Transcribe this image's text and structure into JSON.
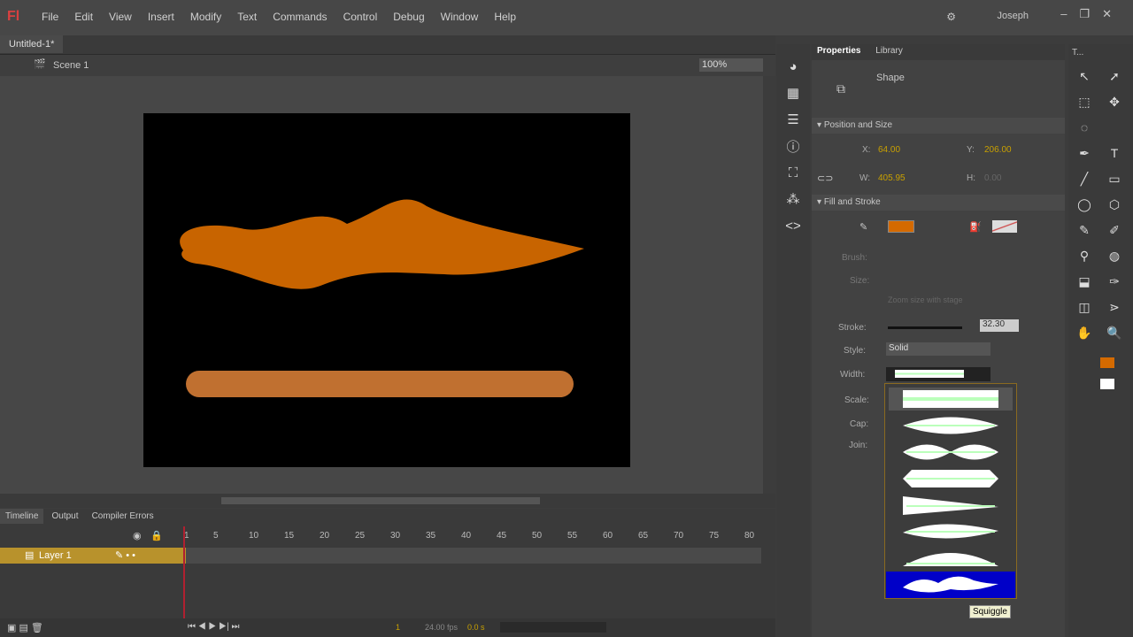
{
  "app": {
    "logo": "Fl",
    "menus": [
      "File",
      "Edit",
      "View",
      "Insert",
      "Modify",
      "Text",
      "Commands",
      "Control",
      "Debug",
      "Window",
      "Help"
    ],
    "user": "Joseph"
  },
  "document": {
    "tab": "Untitled-1*",
    "scene": "Scene 1",
    "zoom": "100%"
  },
  "timeline": {
    "tabs": [
      "Timeline",
      "Output",
      "Compiler Errors"
    ],
    "ticks": [
      "1",
      "5",
      "10",
      "15",
      "20",
      "25",
      "30",
      "35",
      "40",
      "45",
      "50",
      "55",
      "60",
      "65",
      "70",
      "75",
      "80"
    ],
    "layer": "Layer 1",
    "frame": "1",
    "fps": "24.00 fps",
    "time": "0.0 s"
  },
  "properties": {
    "tabs": [
      "Properties",
      "Library"
    ],
    "type": "Shape",
    "position_section": "Position and Size",
    "x_label": "X:",
    "x": "64.00",
    "y_label": "Y:",
    "y": "206.00",
    "w_label": "W:",
    "w": "405.95",
    "h_label": "H:",
    "h": "0.00",
    "fill_section": "Fill and Stroke",
    "brush_label": "Brush:",
    "size_label": "Size:",
    "zoom_check": "Zoom size with stage",
    "stroke_label": "Stroke:",
    "stroke": "32.30",
    "style_label": "Style:",
    "style": "Solid",
    "width_label": "Width:",
    "scale_label": "Scale:",
    "cap_label": "Cap:",
    "join_label": "Join:",
    "fill_color": "#d46a00"
  },
  "tooltip": "Squiggle",
  "colors": {
    "shape": "#c86400",
    "bar": "#c07030",
    "selection": "#0000c8"
  }
}
